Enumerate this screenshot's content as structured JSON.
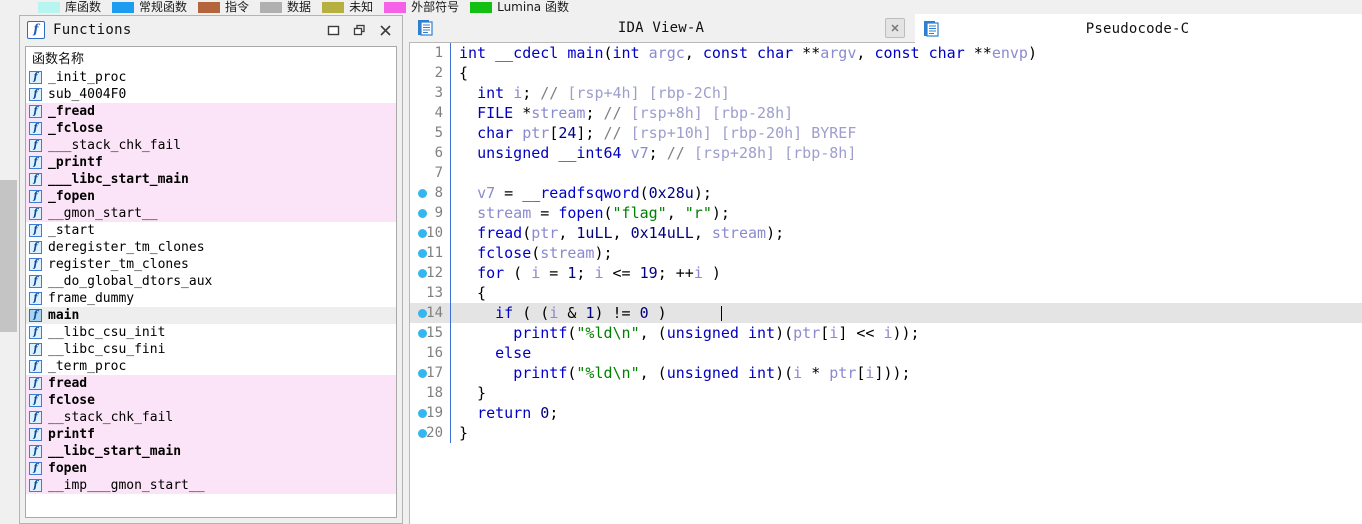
{
  "legend": {
    "items": [
      {
        "color": "#b8f5f0",
        "label": "库函数"
      },
      {
        "color": "#1e9cf0",
        "label": "常规函数"
      },
      {
        "color": "#b5653c",
        "label": "指令"
      },
      {
        "color": "#b0b0b0",
        "label": "数据"
      },
      {
        "color": "#b5b040",
        "label": "未知"
      },
      {
        "color": "#f562e8",
        "label": "外部符号"
      },
      {
        "color": "#14bf14",
        "label": "Lumina 函数"
      }
    ]
  },
  "functions_window": {
    "title": "Functions",
    "badge_glyph": "f",
    "column_header": "函数名称",
    "window_buttons": [
      {
        "name": "maximize-button",
        "tooltip": "Maximize"
      },
      {
        "name": "float-button",
        "tooltip": "Float"
      },
      {
        "name": "close-button",
        "tooltip": "Close"
      }
    ],
    "rows": [
      {
        "name": "_init_proc",
        "highlight": "none",
        "bold": false
      },
      {
        "name": "sub_4004F0",
        "highlight": "none",
        "bold": false
      },
      {
        "name": "_fread",
        "highlight": "pink",
        "bold": true
      },
      {
        "name": "_fclose",
        "highlight": "pink",
        "bold": true
      },
      {
        "name": "___stack_chk_fail",
        "highlight": "pink",
        "bold": false
      },
      {
        "name": "_printf",
        "highlight": "pink",
        "bold": true
      },
      {
        "name": "___libc_start_main",
        "highlight": "pink",
        "bold": true
      },
      {
        "name": "_fopen",
        "highlight": "pink",
        "bold": true
      },
      {
        "name": "__gmon_start__",
        "highlight": "pink",
        "bold": false
      },
      {
        "name": "_start",
        "highlight": "none",
        "bold": false
      },
      {
        "name": "deregister_tm_clones",
        "highlight": "none",
        "bold": false
      },
      {
        "name": "register_tm_clones",
        "highlight": "none",
        "bold": false
      },
      {
        "name": "__do_global_dtors_aux",
        "highlight": "none",
        "bold": false
      },
      {
        "name": "frame_dummy",
        "highlight": "none",
        "bold": false
      },
      {
        "name": "main",
        "highlight": "selected",
        "bold": true
      },
      {
        "name": "__libc_csu_init",
        "highlight": "none",
        "bold": false
      },
      {
        "name": "__libc_csu_fini",
        "highlight": "none",
        "bold": false
      },
      {
        "name": "_term_proc",
        "highlight": "none",
        "bold": false
      },
      {
        "name": "fread",
        "highlight": "pink",
        "bold": true
      },
      {
        "name": "fclose",
        "highlight": "pink",
        "bold": true
      },
      {
        "name": "__stack_chk_fail",
        "highlight": "pink",
        "bold": false
      },
      {
        "name": "printf",
        "highlight": "pink",
        "bold": true
      },
      {
        "name": "__libc_start_main",
        "highlight": "pink",
        "bold": true
      },
      {
        "name": "fopen",
        "highlight": "pink",
        "bold": true
      },
      {
        "name": "__imp___gmon_start__",
        "highlight": "pink",
        "bold": false
      }
    ]
  },
  "tabs": [
    {
      "label": "IDA View-A",
      "active": false,
      "closable": true
    },
    {
      "label": "Pseudocode-C",
      "active": true,
      "closable": false
    }
  ],
  "pseudocode": {
    "current_line": 14,
    "breakpoint_lines": [
      8,
      9,
      10,
      11,
      12,
      14,
      15,
      17,
      19,
      20
    ],
    "lines": [
      {
        "n": 1,
        "text": "int __cdecl main(int argc, const char **argv, const char **envp)"
      },
      {
        "n": 2,
        "text": "{"
      },
      {
        "n": 3,
        "text": "  int i; // [rsp+4h] [rbp-2Ch]"
      },
      {
        "n": 4,
        "text": "  FILE *stream; // [rsp+8h] [rbp-28h]"
      },
      {
        "n": 5,
        "text": "  char ptr[24]; // [rsp+10h] [rbp-20h] BYREF"
      },
      {
        "n": 6,
        "text": "  unsigned __int64 v7; // [rsp+28h] [rbp-8h]"
      },
      {
        "n": 7,
        "text": ""
      },
      {
        "n": 8,
        "text": "  v7 = __readfsqword(0x28u);"
      },
      {
        "n": 9,
        "text": "  stream = fopen(\"flag\", \"r\");"
      },
      {
        "n": 10,
        "text": "  fread(ptr, 1uLL, 0x14uLL, stream);"
      },
      {
        "n": 11,
        "text": "  fclose(stream);"
      },
      {
        "n": 12,
        "text": "  for ( i = 1; i <= 19; ++i )"
      },
      {
        "n": 13,
        "text": "  {"
      },
      {
        "n": 14,
        "text": "    if ( (i & 1) != 0 )"
      },
      {
        "n": 15,
        "text": "      printf(\"%ld\\n\", (unsigned int)(ptr[i] << i));"
      },
      {
        "n": 16,
        "text": "    else"
      },
      {
        "n": 17,
        "text": "      printf(\"%ld\\n\", (unsigned int)(i * ptr[i]));"
      },
      {
        "n": 18,
        "text": "  }"
      },
      {
        "n": 19,
        "text": "  return 0;"
      },
      {
        "n": 20,
        "text": "}"
      }
    ]
  }
}
